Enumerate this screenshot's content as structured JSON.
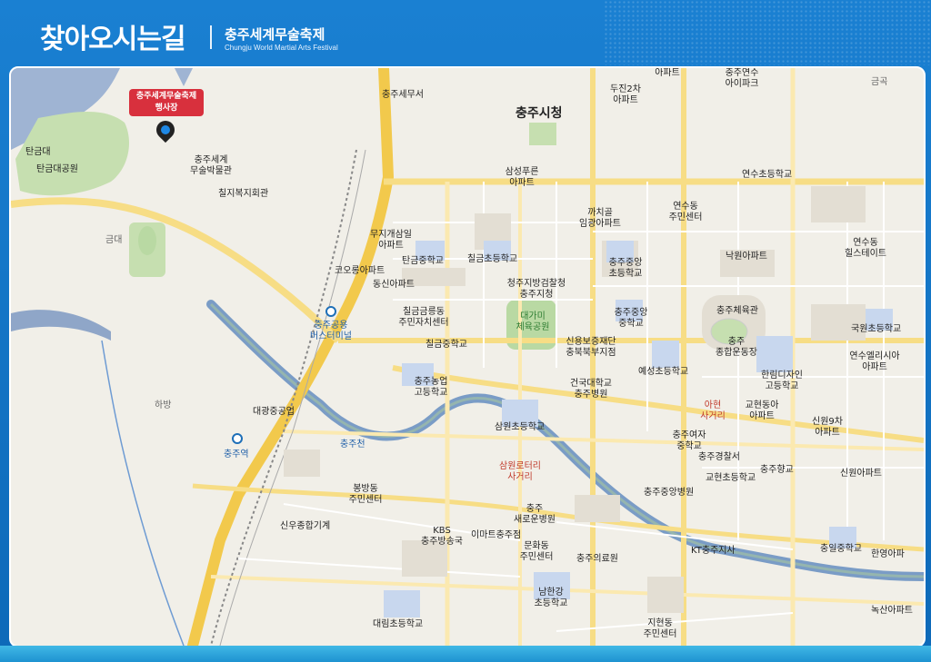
{
  "header": {
    "title": "찾아오시는길",
    "subtitle": "충주세계무술축제",
    "subtitle_en": "Chungju World Martial Arts Festival"
  },
  "marker": {
    "label_line1": "충주세계무술축제",
    "label_line2": "행사장"
  },
  "labels": {
    "city_hall": "충주시청",
    "museum1": "충주세무서",
    "tangeumdae": "탄금대",
    "tangeumdae_park": "탄금대공원",
    "world_museum1": "충주세계",
    "world_museum2": "무술박물관",
    "chilji": "칠지복지회관",
    "geumdae": "금대",
    "muji1": "무지개삼일",
    "muji2": "아파트",
    "tangeum_ms": "탄금중학교",
    "kolon": "코오롱아파트",
    "dongsin": "동신아파트",
    "chilgeum_es": "칠금초등학교",
    "chilgeum_center1": "칠금금릉동",
    "chilgeum_center2": "주민자치센터",
    "chilgeum_ms": "칠금중학교",
    "bus1": "충주공용",
    "bus2": "버스터미널",
    "prosecutor1": "청주지방검찰청",
    "prosecutor2": "충주지청",
    "park1": "대가미",
    "park2": "체육공원",
    "samsung1": "삼성푸른",
    "samsung2": "아파트",
    "kkachi1": "까치골",
    "kkachi2": "임광아파트",
    "yeonsu_center1": "연수동",
    "yeonsu_center2": "주민센터",
    "chungju_central_es1": "충주중앙",
    "chungju_central_es2": "초등학교",
    "chungju_central_ms1": "충주중앙",
    "chungju_central_ms2": "중학교",
    "credit1": "신용보증재단",
    "credit2": "충북북부지점",
    "gymnasium": "충주체육관",
    "stadium1": "충주",
    "stadium2": "종합운동장",
    "yeonsu_es": "연수초등학교",
    "nakwon": "낙원아파트",
    "yeonsu_hill1": "연수동",
    "yeonsu_hill2": "힐스테이트",
    "dujin1": "두진2차",
    "dujin2": "아파트",
    "apt_top": "아파트",
    "yeonsu_ipark1": "충주연수",
    "yeonsu_ipark2": "아이파크",
    "geumneung": "금곡",
    "gukwon_es": "국원초등학교",
    "yeonsu_el1": "연수엘리시아",
    "yeonsu_el2": "아파트",
    "hanlim1": "한림디자인",
    "hanlim2": "고등학교",
    "yeseong_es": "예성초등학교",
    "konkuk1": "건국대학교",
    "konkuk2": "충주병원",
    "agric1": "충주농업",
    "agric2": "고등학교",
    "hyundai_str1": "아현",
    "hyundai_str2": "사거리",
    "gyohyeon_apt1": "교현동아",
    "gyohyeon_apt2": "아파트",
    "sinwon9_1": "신원9차",
    "sinwon9_2": "아파트",
    "hanaglmp": "하방",
    "daegwang": "대광중공업",
    "station": "충주역",
    "river": "충주천",
    "samwon_es": "삼원초등학교",
    "girls_hs1": "충주여자",
    "girls_hs2": "중학교",
    "police": "충주경찰서",
    "gyohyeon_es": "교현초등학교",
    "hyanggyo": "충주향교",
    "sinwon_apt": "신원아파트",
    "bongbang1": "봉방동",
    "bongbang2": "주민센터",
    "rotary1": "삼원로터리",
    "rotary2": "사거리",
    "central_hosp": "충주중앙병원",
    "sinwoo": "신우종합기계",
    "kbs1": "KBS",
    "kbs2": "충주방송국",
    "saenaru1": "충주",
    "saenaru2": "새로운병원",
    "emart": "이마트충주점",
    "munhwa1": "문화동",
    "munhwa2": "주민센터",
    "medical": "충주의료원",
    "kt": "KT충주지사",
    "chungil": "충일중학교",
    "hanyoung": "한영아파",
    "namhan1": "남한강",
    "namhan2": "초등학교",
    "daerim_es": "대림초등학교",
    "jihyeon1": "지현동",
    "jihyeon2": "주민센터",
    "noksan": "녹산아파트"
  }
}
